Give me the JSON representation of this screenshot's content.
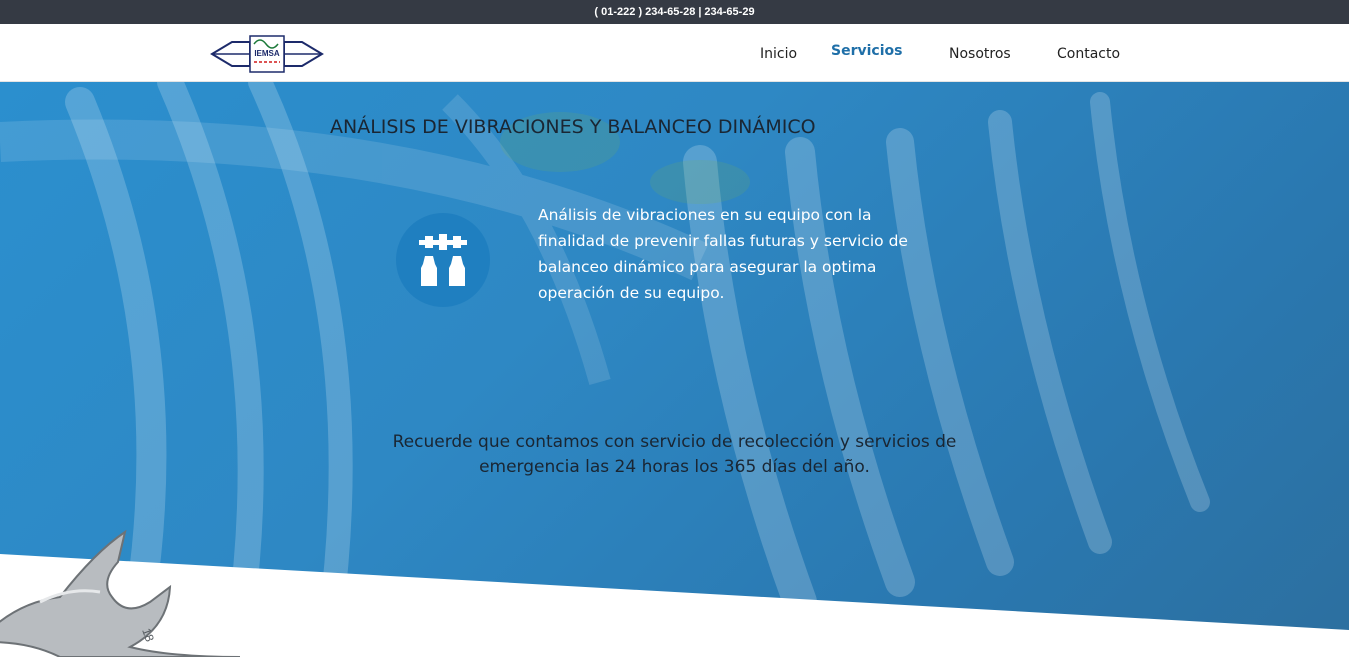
{
  "topbar": {
    "phone_1": "( 01-222 ) 234-65-28",
    "separator": "|",
    "phone_2": "234-65-29"
  },
  "logo": {
    "text": "IEMSA"
  },
  "nav": {
    "items": [
      {
        "label": "Inicio"
      },
      {
        "label": "Servicios",
        "active": true
      },
      {
        "label": "Nosotros"
      },
      {
        "label": "Contacto"
      }
    ],
    "active_color": "#1f6fa8"
  },
  "hero": {
    "title": "ANÁLISIS DE VIBRACIONES Y BALANCEO DINÁMICO",
    "description": "Análisis de vibraciones en su equipo con la finalidad de prevenir fallas futuras y servicio de balanceo dinámico para asegurar la optima operación de su equipo.",
    "icon": "balancing-machine-icon",
    "note_line_1": "Recuerde que contamos con servicio de recolección y servicios de",
    "note_line_2": "emergencia las 24 horas los 365 días del año.",
    "accent_color": "#2e88c4"
  },
  "decor": {
    "image": "wrench-image"
  }
}
